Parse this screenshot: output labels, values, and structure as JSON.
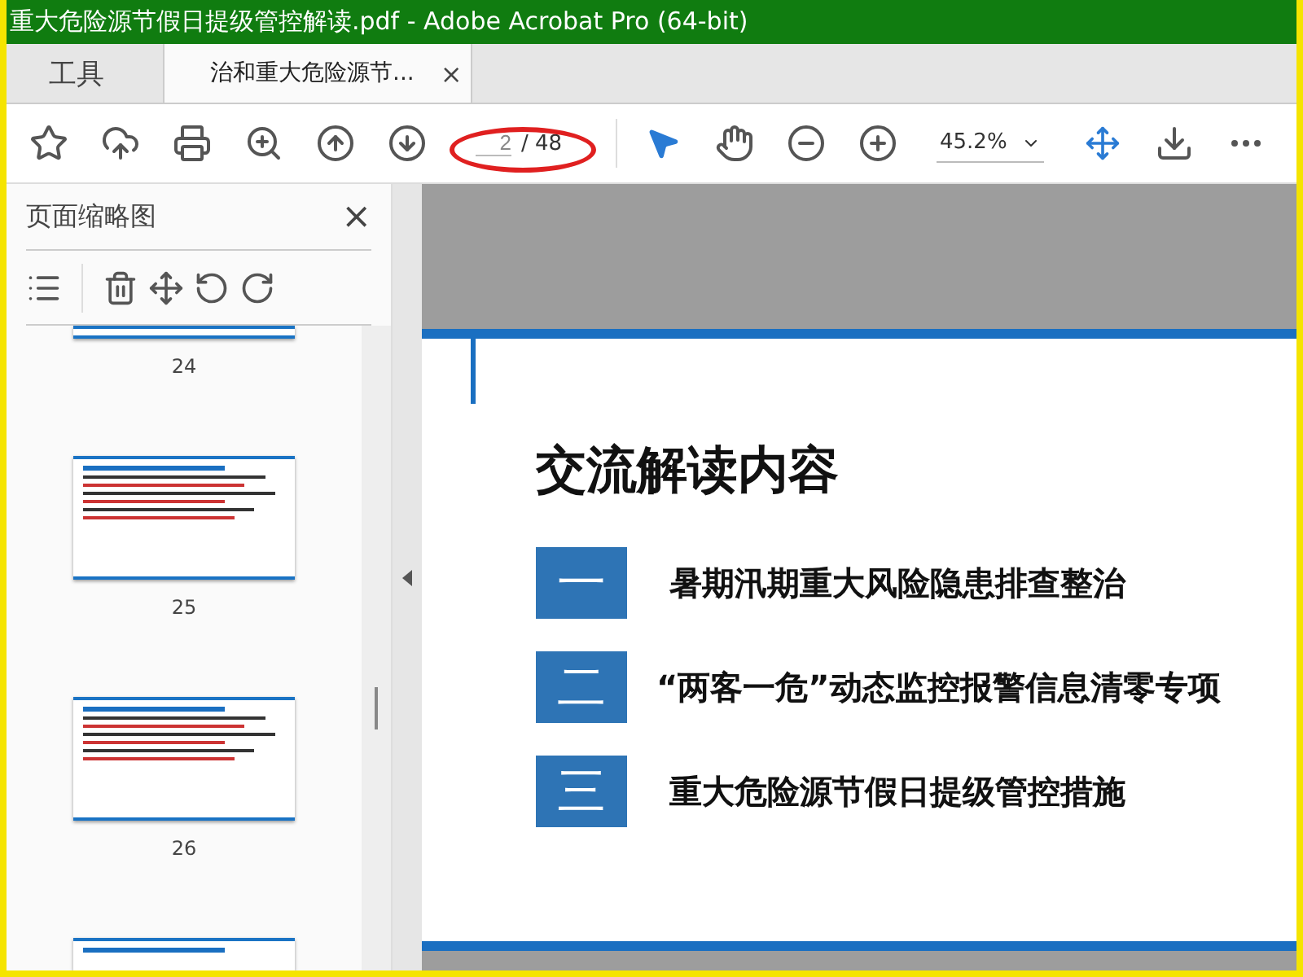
{
  "window": {
    "title": "重大危险源节假日提级管控解读.pdf - Adobe Acrobat Pro (64-bit)"
  },
  "tabs": [
    {
      "label": "工具",
      "selected": false
    },
    {
      "label": "治和重大危险源节...",
      "selected": true,
      "close": "×"
    }
  ],
  "toolbar": {
    "page_value": "2",
    "page_total": "/ 48",
    "zoom": "45.2%"
  },
  "sidebar": {
    "title": "页面缩略图",
    "close": "×",
    "thumbnails": [
      {
        "label": "24",
        "kind": "bottom"
      },
      {
        "label": "25",
        "kind": "full"
      },
      {
        "label": "26",
        "kind": "full"
      },
      {
        "kind": "top"
      }
    ]
  },
  "slide": {
    "title": "交流解读内容",
    "items": [
      {
        "number": "一",
        "text": "暑期汛期重大风险隐患排查整治"
      },
      {
        "number": "二",
        "text": "“两客一危”动态监控报警信息清零专项"
      },
      {
        "number": "三",
        "text": "重大危险源节假日提级管控措施"
      }
    ]
  }
}
